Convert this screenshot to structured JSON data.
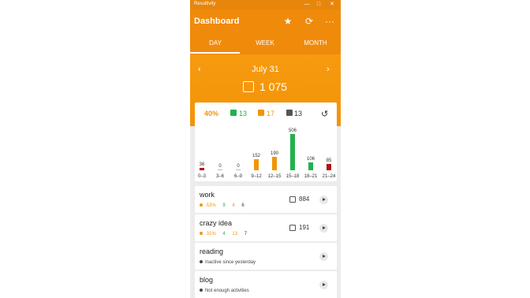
{
  "window": {
    "title": "Resultivity"
  },
  "header": {
    "title": "Dashboard"
  },
  "tabs": [
    "DAY",
    "WEEK",
    "MONTH"
  ],
  "selected_tab": "DAY",
  "hero": {
    "date": "July 31",
    "total": "1 075"
  },
  "stats": {
    "percent": "40%",
    "done": "13",
    "pending": "17",
    "deleted": "13"
  },
  "colors": {
    "orange": "#f39406",
    "green": "#22b14c",
    "red": "#b01010",
    "gray": "#555555"
  },
  "chart_data": {
    "type": "bar",
    "categories": [
      "0–3",
      "3–6",
      "6–9",
      "9–12",
      "12–15",
      "15–18",
      "18–21",
      "21–24"
    ],
    "values": [
      36,
      0,
      0,
      152,
      190,
      506,
      106,
      85
    ],
    "labels": [
      "36",
      "0",
      "0",
      "152",
      "190",
      "506",
      "106",
      "85"
    ],
    "bar_colors": [
      "#b01010",
      "#bbbbbb",
      "#bbbbbb",
      "#f39406",
      "#f39406",
      "#22b14c",
      "#22b14c",
      "#b01010"
    ],
    "ylim": [
      0,
      506
    ]
  },
  "activities": [
    {
      "name": "work",
      "percent": "53%",
      "a": "9",
      "b": "4",
      "c": "6",
      "count": "884"
    },
    {
      "name": "crazy idea",
      "percent": "31%",
      "a": "4",
      "b": "13",
      "c": "7",
      "count": "191"
    },
    {
      "name": "reading",
      "status": "Inactive since yesterday"
    },
    {
      "name": "blog",
      "status": "Not enough activities"
    }
  ]
}
